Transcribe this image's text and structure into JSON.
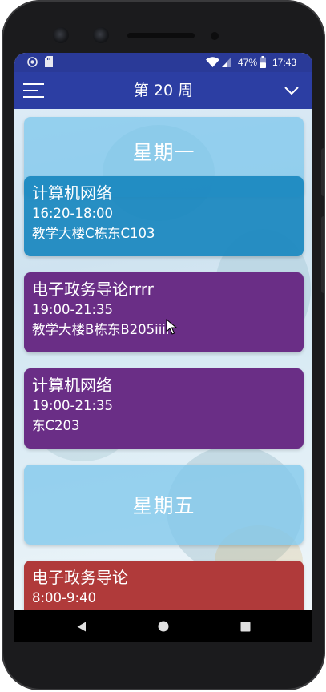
{
  "status_bar": {
    "battery": "47%",
    "time": "17:43"
  },
  "app_bar": {
    "title": "第 20 周"
  },
  "days": [
    {
      "day": "星期一",
      "courses": [
        {
          "name": "计算机网络",
          "time": "16:20-18:00",
          "location": "教学大楼C栋东C103",
          "color": "#1a88bf"
        },
        {
          "name": "电子政务导论rrrr",
          "time": "19:00-21:35",
          "location": "教学大楼B栋东B205iiii",
          "color": "#6a2e86"
        },
        {
          "name": "计算机网络",
          "time": "19:00-21:35",
          "location": "东C203",
          "color": "#6a2e86"
        }
      ]
    },
    {
      "day": "星期五",
      "courses": [
        {
          "name": "电子政务导论",
          "time": "8:00-9:40",
          "location": "",
          "color": "#b03a3a"
        }
      ]
    }
  ],
  "colors": {
    "status_bar": "#2a3a98",
    "app_bar": "#2c3ea3",
    "day_card": "#80c8ec"
  }
}
